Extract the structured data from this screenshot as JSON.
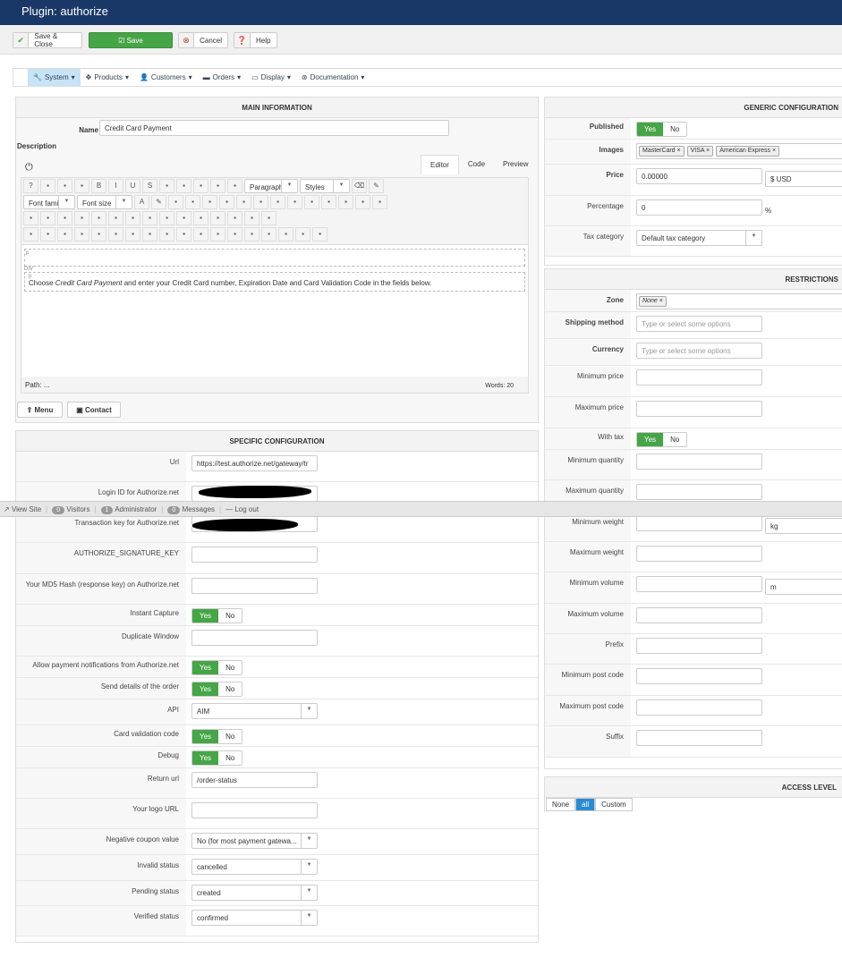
{
  "title": "Plugin: authorize",
  "toolbar": {
    "save_close": "Save & Close",
    "save": "Save",
    "cancel": "Cancel",
    "help": "Help"
  },
  "menu": [
    {
      "label": "System",
      "icon": "wrench-icon",
      "glyph": "🔧"
    },
    {
      "label": "Products",
      "icon": "cubes-icon",
      "glyph": "✥"
    },
    {
      "label": "Customers",
      "icon": "user-icon",
      "glyph": "👤"
    },
    {
      "label": "Orders",
      "icon": "credit-card-icon",
      "glyph": "▬"
    },
    {
      "label": "Display",
      "icon": "monitor-icon",
      "glyph": "▭"
    },
    {
      "label": "Documentation",
      "icon": "lifebuoy-icon",
      "glyph": "⊛"
    }
  ],
  "main": {
    "header": "MAIN INFORMATION",
    "name_label": "Name",
    "name_value": "Credit Card Payment",
    "description_label": "Description",
    "tabs": [
      "Editor",
      "Code",
      "Preview"
    ],
    "editor": {
      "paragraph": "Paragraph",
      "styles": "Styles",
      "font_family": "Font family",
      "font_size": "Font size",
      "block_p1": "p",
      "block_div": "DIV",
      "block_p2": "p",
      "text_before": "Choose ",
      "text_em": "Credit Card Payment",
      "text_after": " and enter your Credit Card number, Expiration Date and Card Validation Code in the fields below.",
      "path": "Path: ...",
      "words": "Words: 20",
      "tools_row1": [
        "help",
        "new-document",
        "undo",
        "redo",
        "bold",
        "italic",
        "underline",
        "strikethrough",
        "align-justify",
        "align-center",
        "align-left",
        "align-right",
        "blockquote"
      ],
      "tools_row2": [
        "cut",
        "copy",
        "paste",
        "paste-text",
        "indent",
        "outdent",
        "ordered-list",
        "unordered-list",
        "subscript",
        "superscript",
        "format",
        "special-char",
        "horizontal-rule"
      ],
      "tools_row3": [
        "ltr",
        "rtl",
        "fullscreen",
        "print",
        "search",
        "table",
        "table-delete",
        "row-before",
        "row-after",
        "row-delete",
        "col-before",
        "col-after",
        "col-delete",
        "merge",
        "split"
      ],
      "tools_row4": [
        "visual-aid",
        "show-blocks",
        "template",
        "image",
        "style",
        "cite",
        "abbr",
        "acronym",
        "del",
        "ins",
        "media",
        "anchor",
        "nonbreaking",
        "pagebreak",
        "iframe",
        "spellcheck",
        "hr-table",
        "layer"
      ]
    },
    "menu_button": "Menu",
    "contact_button": "Contact"
  },
  "specific": {
    "header": "SPECIFIC CONFIGURATION",
    "rows": [
      {
        "label": "Url",
        "type": "input",
        "value": "https://test.authorize.net/gateway/tr"
      },
      {
        "label": "Login ID for Authorize.net",
        "type": "redacted"
      },
      {
        "label": "Transaction key for Authorize.net",
        "type": "redacted"
      },
      {
        "label": "AUTHORIZE_SIGNATURE_KEY",
        "type": "input",
        "value": ""
      },
      {
        "label": "Your MD5 Hash (response key) on Authorize.net",
        "type": "input",
        "value": ""
      },
      {
        "label": "Instant Capture",
        "type": "toggle",
        "on": true
      },
      {
        "label": "Duplicate Window",
        "type": "input",
        "value": ""
      },
      {
        "label": "Allow payment notifications from Authorize.net",
        "type": "toggle",
        "on": true
      },
      {
        "label": "Send details of the order",
        "type": "toggle",
        "on": true
      },
      {
        "label": "API",
        "type": "select",
        "value": "AIM"
      },
      {
        "label": "Card validation code",
        "type": "toggle",
        "on": true
      },
      {
        "label": "Debug",
        "type": "toggle",
        "on": true
      },
      {
        "label": "Return url",
        "type": "input",
        "value": "/order-status"
      },
      {
        "label": "Your logo URL",
        "type": "input",
        "value": ""
      },
      {
        "label": "Negative coupon value",
        "type": "select",
        "value": "No (for most payment gatewa..."
      },
      {
        "label": "Invalid status",
        "type": "select",
        "value": "cancelled"
      },
      {
        "label": "Pending status",
        "type": "select",
        "value": "created"
      },
      {
        "label": "Verified status",
        "type": "select",
        "value": "confirmed"
      }
    ]
  },
  "yes": "Yes",
  "no": "No",
  "generic": {
    "header": "GENERIC CONFIGURATION",
    "rows": [
      {
        "label": "Published",
        "bold": true,
        "type": "toggle",
        "on": true
      },
      {
        "label": "Images",
        "bold": true,
        "type": "tags",
        "tags": [
          "MasterCard",
          "VISA",
          "American Express"
        ]
      },
      {
        "label": "Price",
        "bold": true,
        "type": "input",
        "value": "0.00000",
        "extra": "$ USD"
      },
      {
        "label": "Percentage",
        "type": "input",
        "value": "0",
        "suffix": "%"
      },
      {
        "label": "Tax category",
        "type": "select",
        "value": "Default tax category"
      }
    ]
  },
  "restrictions": {
    "header": "RESTRICTIONS",
    "rows": [
      {
        "label": "Zone",
        "bold": true,
        "type": "tags",
        "tags": [
          "None"
        ]
      },
      {
        "label": "Shipping method",
        "bold": true,
        "type": "placeholder",
        "value": "Type or select some options"
      },
      {
        "label": "Currency",
        "bold": true,
        "type": "placeholder",
        "value": "Type or select some options"
      },
      {
        "label": "Minimum price",
        "type": "input",
        "value": ""
      },
      {
        "label": "Maximum price",
        "type": "input",
        "value": ""
      },
      {
        "label": "With tax",
        "type": "toggle",
        "on": true
      },
      {
        "label": "Minimum quantity",
        "type": "input",
        "value": ""
      },
      {
        "label": "Maximum quantity",
        "type": "input",
        "value": ""
      },
      {
        "label": "Minimum weight",
        "type": "input",
        "value": "",
        "extra": "kg"
      },
      {
        "label": "Maximum weight",
        "type": "input",
        "value": ""
      },
      {
        "label": "Minimum volume",
        "type": "input",
        "value": "",
        "extra": "m"
      },
      {
        "label": "Maximum volume",
        "type": "input",
        "value": ""
      },
      {
        "label": "Prefix",
        "type": "input",
        "value": ""
      },
      {
        "label": "Minimum post code",
        "type": "input",
        "value": ""
      },
      {
        "label": "Maximum post code",
        "type": "input",
        "value": ""
      },
      {
        "label": "Suffix",
        "type": "input",
        "value": ""
      }
    ]
  },
  "access": {
    "header": "ACCESS LEVEL",
    "options": [
      "None",
      "all",
      "Custom"
    ],
    "selected": "all"
  },
  "adminbar": {
    "view_site": "View Site",
    "visitors_count": "0",
    "visitors": "Visitors",
    "admin_count": "1",
    "admin": "Administrator",
    "messages_count": "0",
    "messages": "Messages",
    "logout": "Log out"
  },
  "colors": {
    "header": "#1a3867",
    "green": "#46a546",
    "active_menu": "#c7e3f5"
  }
}
